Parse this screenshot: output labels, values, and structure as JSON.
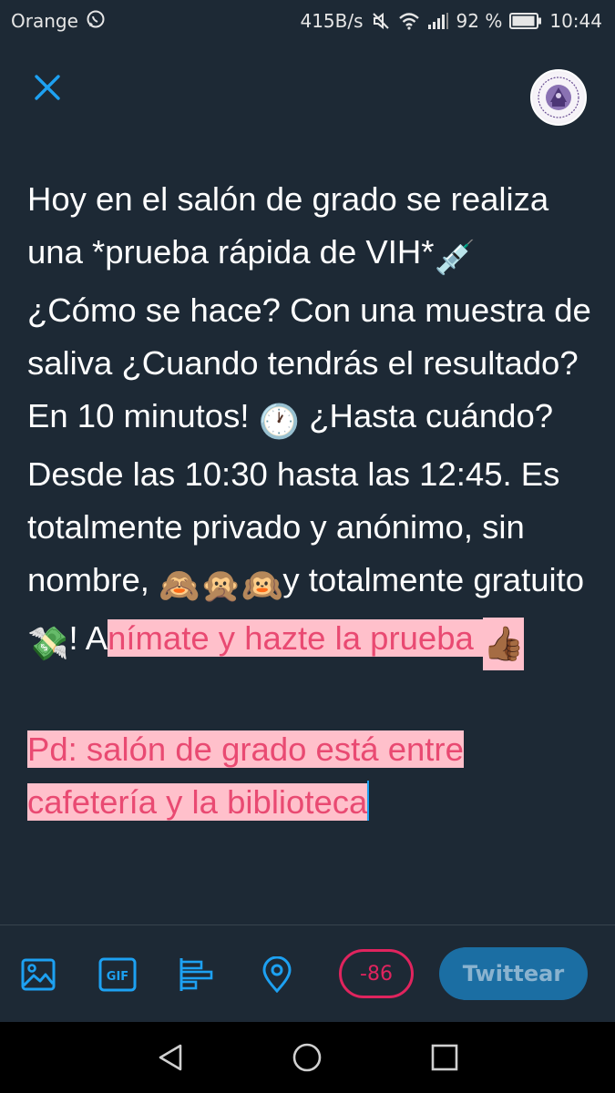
{
  "status_bar": {
    "carrier": "Orange",
    "speed": "415B/s",
    "battery": "92 %",
    "time": "10:44",
    "icons": [
      "whatsapp-icon",
      "mute-icon",
      "wifi-icon",
      "signal-icon",
      "battery-icon"
    ]
  },
  "header": {
    "close_icon": "close-icon",
    "avatar": "profile-avatar"
  },
  "compose": {
    "part1": "Hoy en el salón de grado se realiza una *prueba rápida de VIH*",
    "emoji_syringe": "💉",
    "part2": " ¿Cómo se hace? Con una muestra de saliva ¿Cuando tendrás el resultado? En 10 minutos! ",
    "emoji_clock": "🕐",
    "part3": " ¿Hasta cuándo? Desde las 10:30 hasta las 12:45. Es totalmente privado y anónimo, sin nombre,  ",
    "emoji_monkeys": "🙈🙊🙉",
    "part4": "y totalmente gratuito",
    "emoji_money": "💸",
    "part5": "! A",
    "over1": "nímate y hazte la prueba ",
    "emoji_thumb": "👍🏾",
    "over2": "Pd: salón de grado está entre cafetería y la biblioteca"
  },
  "toolbar": {
    "icons": [
      "image-icon",
      "gif-icon",
      "poll-icon",
      "location-icon"
    ],
    "gif_label": "GIF",
    "char_count": "-86",
    "tweet_label": "Twittear"
  },
  "colors": {
    "background": "#1d2935",
    "accent": "#1da1f2",
    "over_limit": "#e0245e",
    "highlight": "#ffc0cb"
  },
  "nav_bar": {
    "icons": [
      "back-icon",
      "home-icon",
      "recents-icon"
    ]
  }
}
